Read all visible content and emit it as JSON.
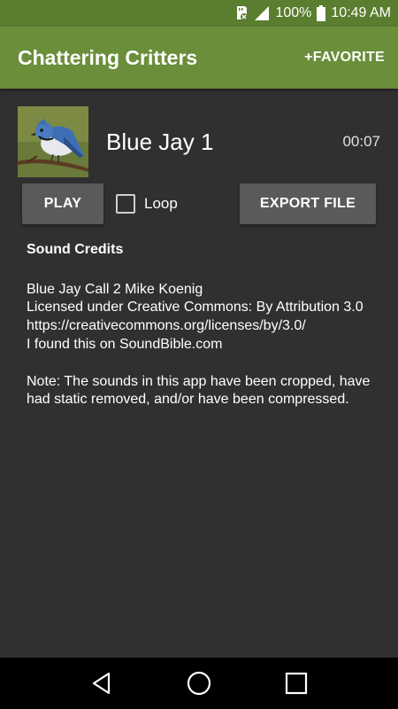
{
  "status_bar": {
    "battery_percent": "100%",
    "time": "10:49 AM"
  },
  "app_bar": {
    "title": "Chattering Critters",
    "favorite_label": "+FAVORITE"
  },
  "sound": {
    "name": "Blue Jay 1",
    "duration": "00:07",
    "thumbnail_icon": "blue-jay-photo"
  },
  "controls": {
    "play_label": "PLAY",
    "loop_label": "Loop",
    "loop_checked": false,
    "export_label": "EXPORT FILE"
  },
  "credits": {
    "title": "Sound Credits",
    "body": "Blue Jay Call 2 Mike Koenig\nLicensed under Creative Commons: By Attribution 3.0\nhttps://creativecommons.org/licenses/by/3.0/\nI found this on SoundBible.com",
    "note": "Note: The sounds in this app have been cropped, have had static removed, and/or have been compressed."
  },
  "colors": {
    "app_bar": "#6b8e3a",
    "status_bar": "#5a7d2f",
    "background": "#303030",
    "button": "#5a5a5a"
  }
}
